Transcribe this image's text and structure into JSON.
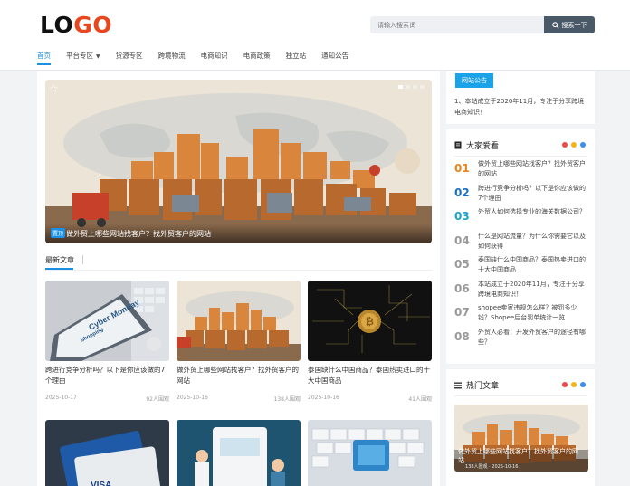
{
  "header": {
    "logo_part1": "LO",
    "logo_part2": "GO",
    "search": {
      "placeholder": "请输入搜索词",
      "button": "搜索一下"
    },
    "nav": [
      {
        "label": "首页",
        "active": true
      },
      {
        "label": "平台专区",
        "dropdown": true
      },
      {
        "label": "货源专区"
      },
      {
        "label": "跨境物流"
      },
      {
        "label": "电商知识"
      },
      {
        "label": "电商政策"
      },
      {
        "label": "独立站"
      },
      {
        "label": "通知公告"
      }
    ]
  },
  "hero": {
    "tag": "置顶",
    "title": "做外贸上哪些网站找客户？找外贸客户的网站",
    "slide_count": 4,
    "active_slide": 1
  },
  "latest": {
    "tab": "最新文章",
    "cards": [
      {
        "title": "跨进行竞争分析吗？以下是你应该做的7个理由",
        "date": "2025-10-17",
        "views": "92人围观"
      },
      {
        "title": "做外贸上哪些网站找客户？找外贸客户的网站",
        "date": "2025-10-16",
        "views": "138人围观"
      },
      {
        "title": "泰国缺什么中国商品？泰国热卖进口的十大中国商品",
        "date": "2025-10-16",
        "views": "41人围观"
      }
    ]
  },
  "notice": {
    "tag": "网站公告",
    "text": "1、本站成立于2020年11月，专注于分享跨境电商知识！"
  },
  "popular": {
    "title": "大家爱看",
    "items": [
      {
        "num": "01",
        "text": "做外贸上哪些网站找客户？找外贸客户的网站"
      },
      {
        "num": "02",
        "text": "跨进行竞争分析吗？以下是你应该做的7个理由"
      },
      {
        "num": "03",
        "text": "外贸人如何选择专业的海关数据公司？"
      },
      {
        "num": "04",
        "text": "什么是网站流量？为什么你需要它以及如何获得"
      },
      {
        "num": "05",
        "text": "泰国缺什么中国商品？泰国热卖进口的十大中国商品"
      },
      {
        "num": "06",
        "text": "本站成立于2020年11月，专注于分享跨境电商知识！"
      },
      {
        "num": "07",
        "text": "shopee卖家违规怎么样？被罚多少钱？Shopee后台罚单统计一览"
      },
      {
        "num": "08",
        "text": "外贸人必看：开发外贸客户的途径有哪些？"
      }
    ],
    "num_colors": [
      "#e8841c",
      "#1a6fc9",
      "#1aa3c9",
      "#999999"
    ]
  },
  "hot": {
    "title": "热门文章",
    "caption": "做外贸上哪些网站找客户？找外贸客户的网站",
    "meta": "138人围观 · 2025-10-16"
  },
  "colors": {
    "accent": "#1a8fe3",
    "logo_red": "#e8461c",
    "search_button": "#4a5968",
    "dot_red": "#f04848",
    "dot_yellow": "#f6b319",
    "dot_blue": "#3b8ff0"
  }
}
